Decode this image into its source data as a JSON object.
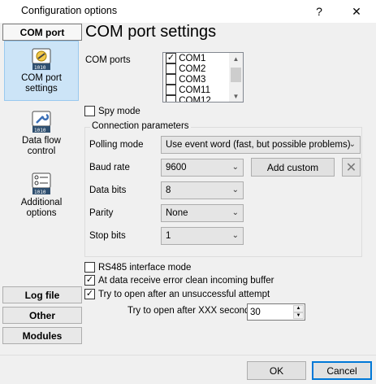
{
  "window": {
    "title": "Configuration options",
    "help": "?",
    "close": "✕"
  },
  "nav": {
    "top_tab": "COM port",
    "items": [
      {
        "label_line1": "COM port",
        "label_line2": "settings"
      },
      {
        "label_line1": "Data flow",
        "label_line2": "control"
      },
      {
        "label_line1": "Additional",
        "label_line2": "options"
      }
    ],
    "bottom_tabs": [
      "Log file",
      "Other",
      "Modules"
    ]
  },
  "main": {
    "heading": "COM port settings",
    "com_ports_label": "COM ports",
    "com_ports": [
      {
        "name": "COM1",
        "checked": true
      },
      {
        "name": "COM2",
        "checked": false
      },
      {
        "name": "COM3",
        "checked": false
      },
      {
        "name": "COM11",
        "checked": false
      },
      {
        "name": "COM12",
        "checked": false
      }
    ],
    "spy_mode_label": "Spy mode",
    "spy_mode": false,
    "group_title": "Connection parameters",
    "polling_mode_label": "Polling mode",
    "polling_mode_value": "Use event word (fast, but possible problems)",
    "baud_rate_label": "Baud rate",
    "baud_rate_value": "9600",
    "add_custom_label": "Add custom",
    "data_bits_label": "Data bits",
    "data_bits_value": "8",
    "parity_label": "Parity",
    "parity_value": "None",
    "stop_bits_label": "Stop bits",
    "stop_bits_value": "1",
    "rs485_label": "RS485 interface mode",
    "rs485": false,
    "clean_buffer_label": "At data receive error clean incoming buffer",
    "clean_buffer": true,
    "retry_label": "Try to open after an unsuccessful attempt",
    "retry": true,
    "retry_seconds_label": "Try to open after XXX seconds",
    "retry_seconds_value": "30"
  },
  "footer": {
    "ok": "OK",
    "cancel": "Cancel"
  },
  "colors": {
    "selection_bg": "#cce4f7",
    "selection_border": "#99c9ef",
    "primary_border": "#0078d7"
  }
}
